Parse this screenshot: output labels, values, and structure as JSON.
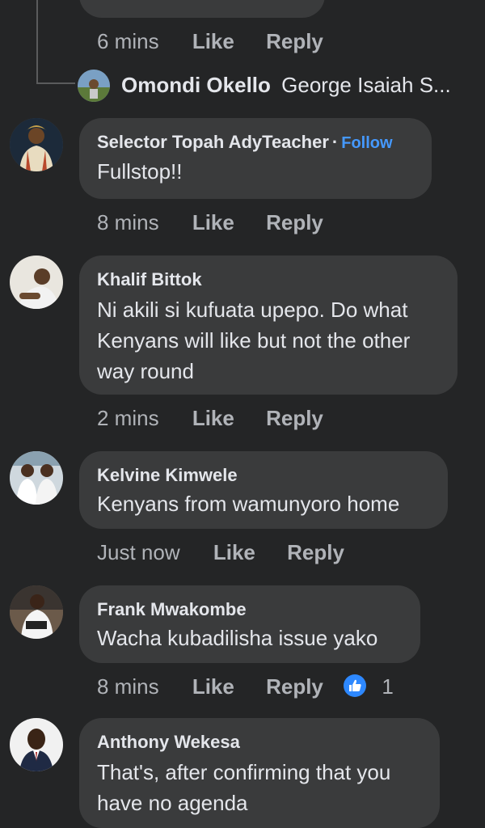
{
  "top_comment": {
    "time": "6 mins",
    "like_label": "Like",
    "reply_label": "Reply"
  },
  "collapsed_reply": {
    "author": "Omondi Okello",
    "preview": "George Isaiah S..."
  },
  "comments": [
    {
      "author": "Selector Topah AdyTeacher",
      "follow_label": "Follow",
      "text": "Fullstop!!",
      "time": "8 mins",
      "like_label": "Like",
      "reply_label": "Reply"
    },
    {
      "author": "Khalif Bittok",
      "text": "Ni akili si kufuata upepo. Do what Kenyans will like but not the other way round",
      "time": "2 mins",
      "like_label": "Like",
      "reply_label": "Reply"
    },
    {
      "author": "Kelvine Kimwele",
      "text": "Kenyans from wamunyoro home",
      "time": "Just now",
      "like_label": "Like",
      "reply_label": "Reply"
    },
    {
      "author": "Frank Mwakombe",
      "text": "Wacha kubadilisha issue yako",
      "time": "8 mins",
      "like_label": "Like",
      "reply_label": "Reply",
      "reaction_icon": "thumbs-up-icon",
      "reaction_count": "1"
    },
    {
      "author": "Anthony Wekesa",
      "text": "That's, after confirming that you have no agenda"
    }
  ],
  "colors": {
    "background": "#242526",
    "bubble": "#3a3b3c",
    "follow": "#4599ff",
    "reaction": "#2d88ff"
  }
}
